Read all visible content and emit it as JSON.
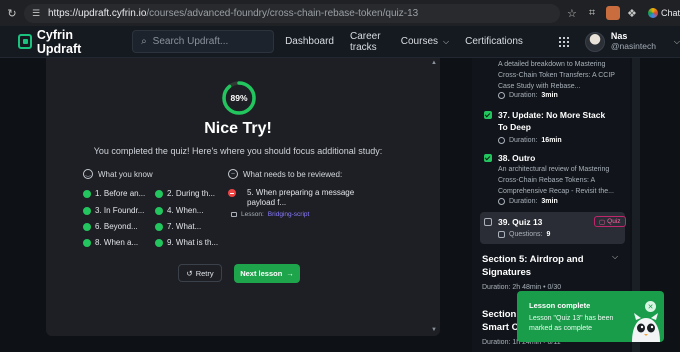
{
  "browser": {
    "url_host": "https://updraft.cyfrin.io",
    "url_path": "/courses/advanced-foundry/cross-chain-rebase-token/quiz-13",
    "chat_label": "Chat",
    "colors": {
      "ext1": "#c96c3e",
      "ext2": "#6f7b8a",
      "ext3": "#3f8f5b"
    }
  },
  "header": {
    "brand": "Cyfrin Updraft",
    "search_placeholder": "Search Updraft...",
    "nav": [
      "Dashboard",
      "Career tracks",
      "Courses",
      "Certifications"
    ],
    "user_name": "Nas",
    "user_handle": "@nasintech"
  },
  "result": {
    "score_label": "89%",
    "score_fraction": 0.89,
    "title": "Nice Try!",
    "subtitle": "You completed the quiz! Here's where you should focus additional study:",
    "known_header": "What you know",
    "review_header": "What needs to be reviewed:",
    "known": [
      "1. Before an...",
      "2. During th...",
      "3. In Foundr...",
      "4. When...",
      "6. Beyond...",
      "7. What...",
      "8. When a...",
      "9. What is th..."
    ],
    "review_item": "5. When preparing a message payload f...",
    "lesson_prefix": "Lesson:",
    "lesson_link": "Bridging-script",
    "retry_label": "Retry",
    "next_label": "Next lesson"
  },
  "sidebar": {
    "item36": {
      "desc": "A detailed breakdown to Mastering Cross-Chain Token Transfers: A CCIP Case Study with Rebase...",
      "duration_prefix": "Duration:",
      "duration": "3min"
    },
    "item37": {
      "title": "37. Update: No More Stack To Deep",
      "duration_prefix": "Duration:",
      "duration": "16min"
    },
    "item38": {
      "title": "38. Outro",
      "desc": "An architectural review of Mastering Cross-Chain Rebase Tokens: A Comprehensive Recap - Revisit the...",
      "duration_prefix": "Duration:",
      "duration": "3min"
    },
    "item39": {
      "title": "39. Quiz 13",
      "tag": "Quiz",
      "questions_prefix": "Questions:",
      "questions": "9"
    },
    "section5": {
      "title": "Section 5: Airdrop and Signatures",
      "meta": "Duration: 2h 48min • 0/30"
    },
    "section6": {
      "title": "Section",
      "title_line2": "Smart C",
      "meta": "Duration: 1h 24min • 0/11"
    }
  },
  "toast": {
    "title": "Lesson complete",
    "body": "Lesson \"Quiz 13\" has been marked as complete"
  },
  "colors": {
    "accent": "#19c37d",
    "success": "#22c55e",
    "error": "#ef4444",
    "quiz_tag": "#ff63a5",
    "toast_bg": "#1a9d4b"
  }
}
